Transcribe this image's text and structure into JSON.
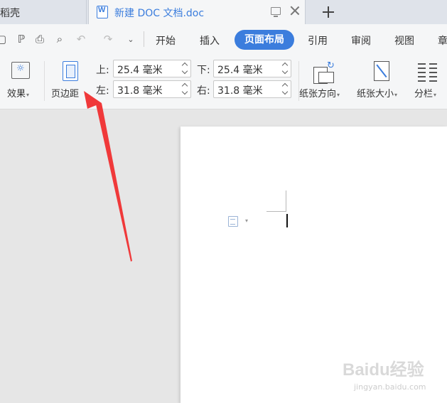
{
  "tabs": {
    "left_partial": "稻壳",
    "active_title": "新建 DOC 文档.doc"
  },
  "menu": {
    "items": [
      "开始",
      "插入",
      "页面布局",
      "引用",
      "审阅",
      "视图",
      "章"
    ],
    "active": "页面布局"
  },
  "quick_access": {
    "icons": [
      "save-icon",
      "format-painter-icon",
      "print-icon",
      "print-preview-icon",
      "undo-icon",
      "redo-icon",
      "customize-icon"
    ]
  },
  "ribbon": {
    "effect_label": "效果",
    "margins_label": "页边距",
    "top_label": "上:",
    "top_value": "25.4 毫米",
    "bottom_label": "下:",
    "bottom_value": "25.4 毫米",
    "left_label": "左:",
    "left_value": "31.8 毫米",
    "right_label": "右:",
    "right_value": "31.8 毫米",
    "orientation_label": "纸张方向",
    "size_label": "纸张大小",
    "columns_label": "分栏"
  },
  "colors": {
    "accent": "#3b7ddd",
    "annotation_arrow": "#f0393a"
  },
  "watermark": {
    "brand": "Baidu经验",
    "url": "jingyan.baidu.com"
  }
}
